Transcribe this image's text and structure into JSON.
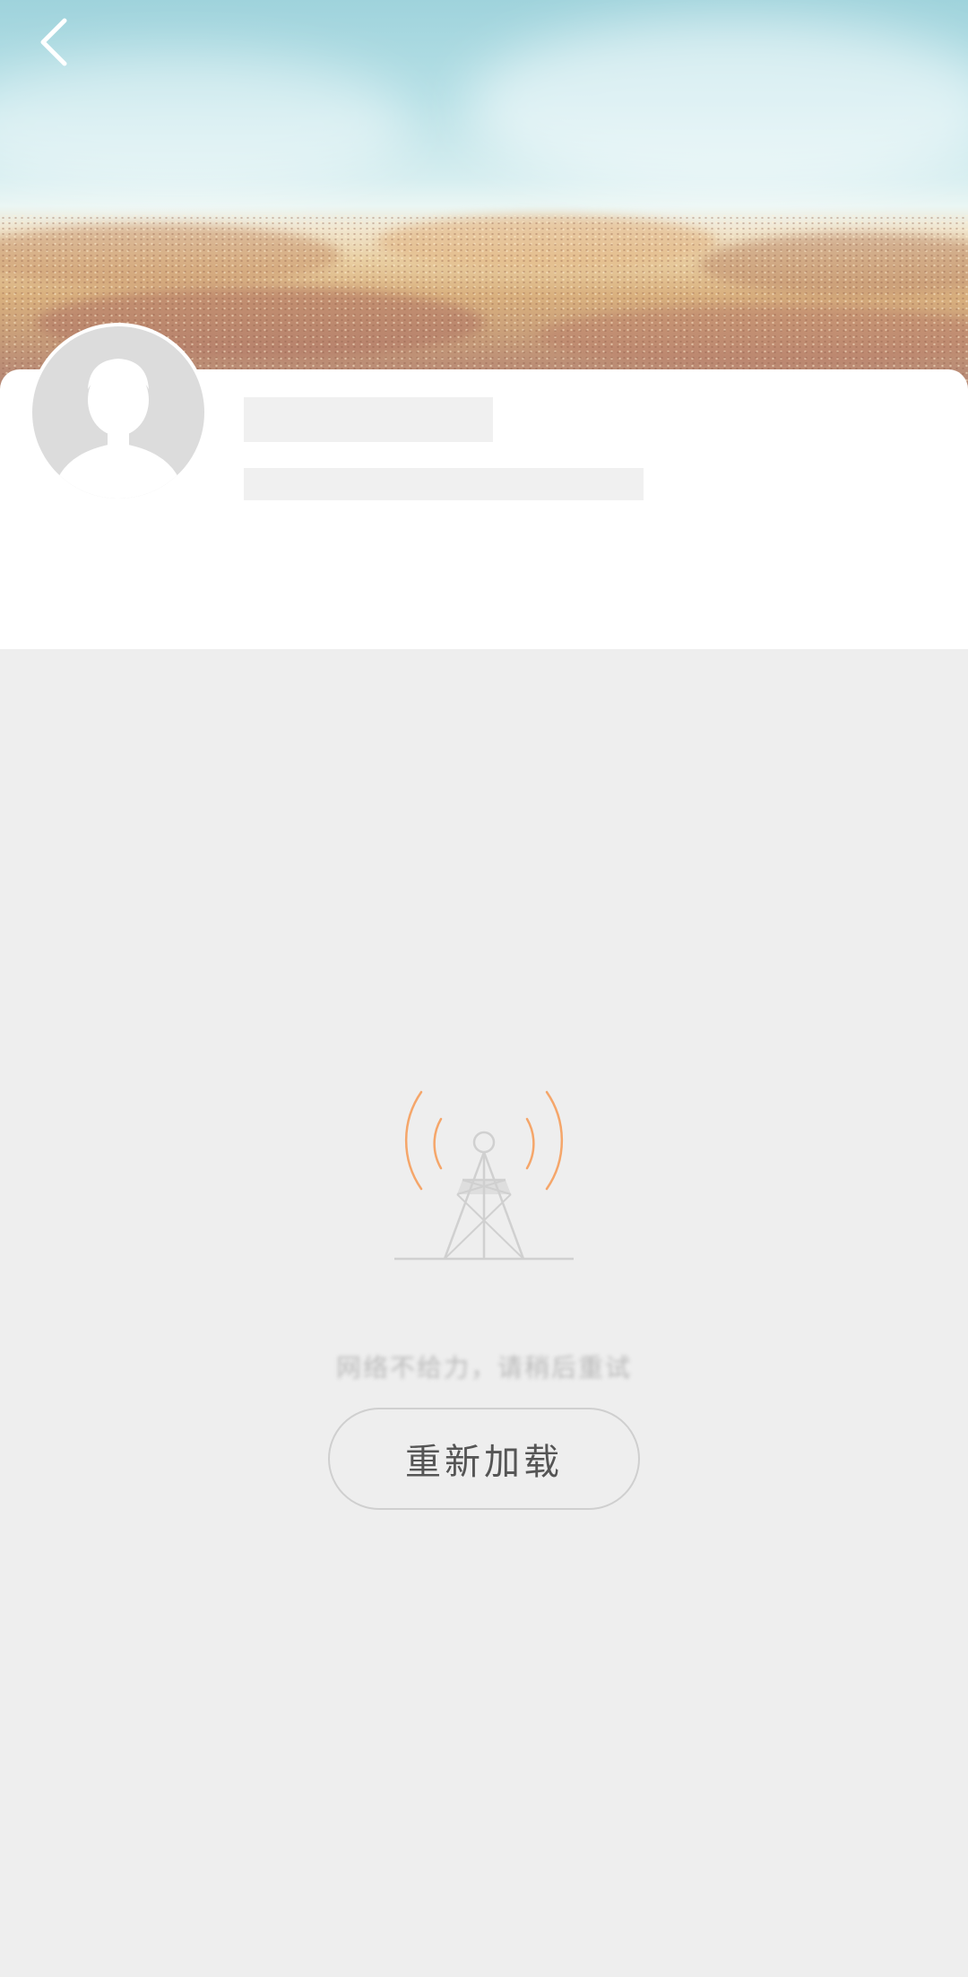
{
  "header": {
    "back_icon": "chevron-left-icon",
    "banner_image": "beach-sand-sky"
  },
  "profile": {
    "avatar_icon": "default-avatar-silhouette",
    "name": "",
    "bio": ""
  },
  "error_state": {
    "icon": "signal-tower-icon",
    "message": "网络不给力，请稍后重试",
    "reload_label": "重新加载"
  },
  "colors": {
    "page_background": "#eeeeee",
    "card_background": "#ffffff",
    "skeleton": "#f0f0f0",
    "signal_waves": "#f5a66a",
    "tower": "#d0d0d0",
    "button_border": "#cfcfcf",
    "button_text": "#555555"
  }
}
